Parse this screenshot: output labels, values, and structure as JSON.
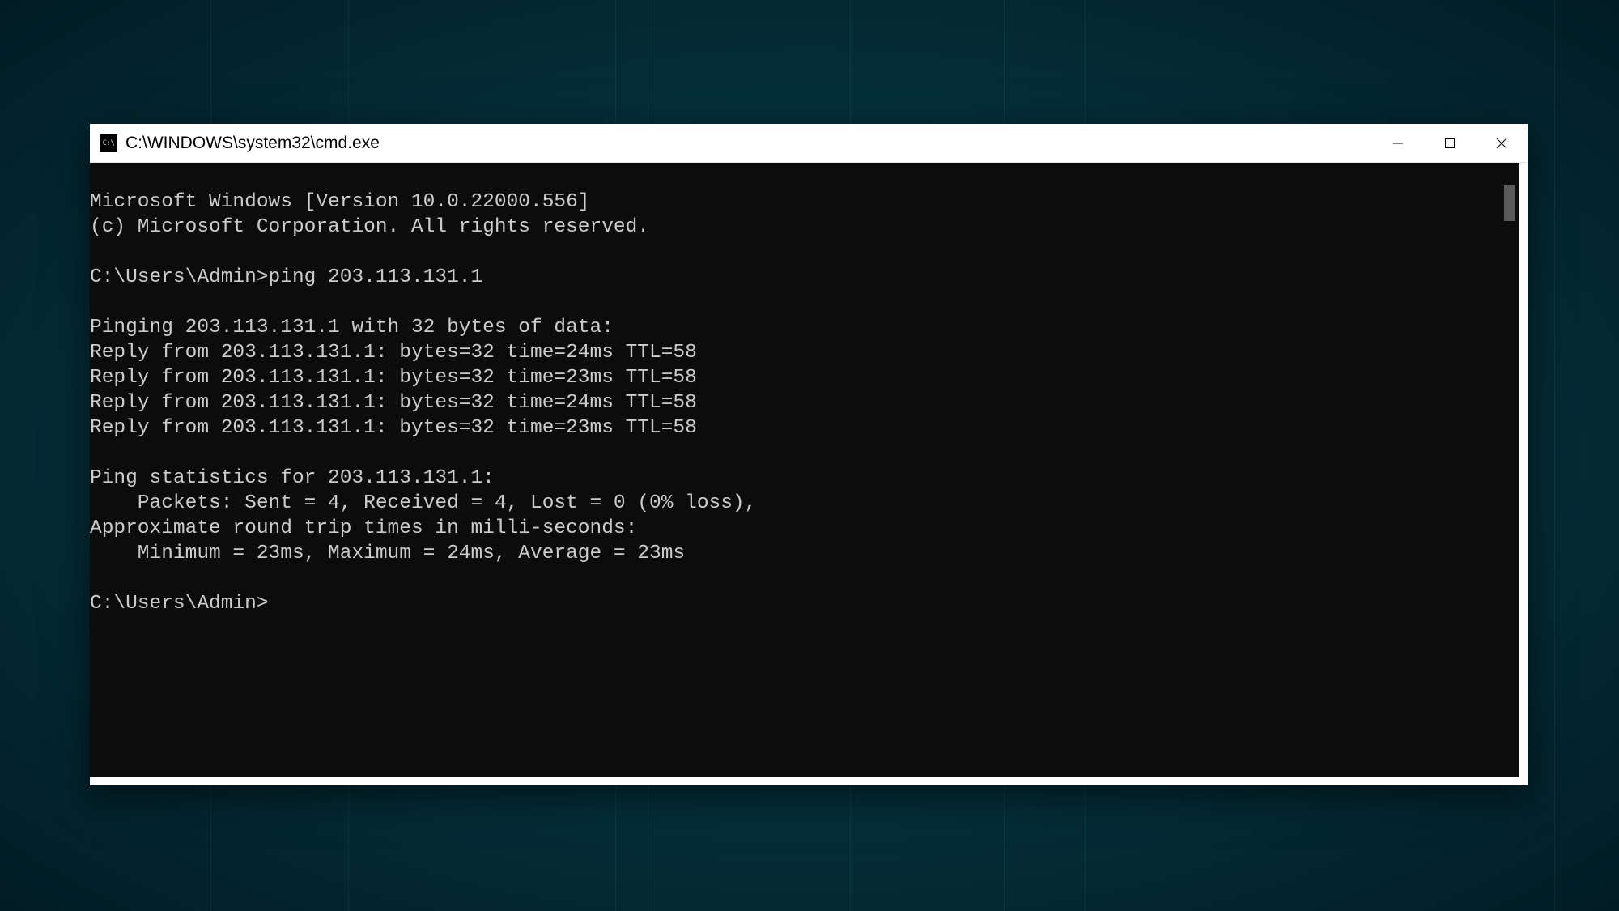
{
  "window": {
    "title": "C:\\WINDOWS\\system32\\cmd.exe",
    "icon_label": "C:\\"
  },
  "terminal": {
    "lines": [
      "Microsoft Windows [Version 10.0.22000.556]",
      "(c) Microsoft Corporation. All rights reserved.",
      "",
      "C:\\Users\\Admin>ping 203.113.131.1",
      "",
      "Pinging 203.113.131.1 with 32 bytes of data:",
      "Reply from 203.113.131.1: bytes=32 time=24ms TTL=58",
      "Reply from 203.113.131.1: bytes=32 time=23ms TTL=58",
      "Reply from 203.113.131.1: bytes=32 time=24ms TTL=58",
      "Reply from 203.113.131.1: bytes=32 time=23ms TTL=58",
      "",
      "Ping statistics for 203.113.131.1:",
      "    Packets: Sent = 4, Received = 4, Lost = 0 (0% loss),",
      "Approximate round trip times in milli-seconds:",
      "    Minimum = 23ms, Maximum = 24ms, Average = 23ms",
      "",
      "C:\\Users\\Admin>"
    ]
  },
  "controls": {
    "minimize": "Minimize",
    "maximize": "Maximize",
    "close": "Close"
  }
}
